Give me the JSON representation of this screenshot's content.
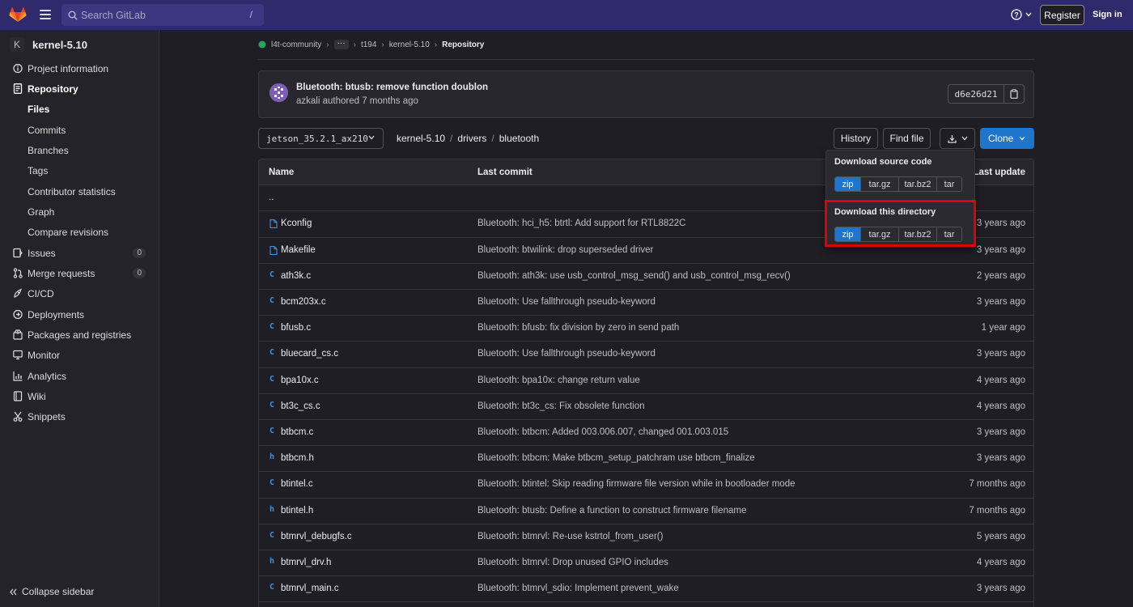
{
  "topbar": {
    "search_placeholder": "Search GitLab",
    "search_shortcut": "/",
    "register_label": "Register",
    "signin_label": "Sign in",
    "logo_icon": "gitlab-tanuki-icon",
    "help_icon": "help-icon"
  },
  "sidebar": {
    "project_initial": "K",
    "project_name": "kernel-5.10",
    "items": [
      {
        "label": "Project information",
        "icon": "info-icon"
      },
      {
        "label": "Repository",
        "icon": "doc-icon"
      },
      {
        "label": "Files"
      },
      {
        "label": "Commits"
      },
      {
        "label": "Branches"
      },
      {
        "label": "Tags"
      },
      {
        "label": "Contributor statistics"
      },
      {
        "label": "Graph"
      },
      {
        "label": "Compare revisions"
      },
      {
        "label": "Issues",
        "icon": "issues-icon",
        "count": "0"
      },
      {
        "label": "Merge requests",
        "icon": "merge-request-icon",
        "count": "0"
      },
      {
        "label": "CI/CD",
        "icon": "rocket-icon"
      },
      {
        "label": "Deployments",
        "icon": "deployments-icon"
      },
      {
        "label": "Packages and registries",
        "icon": "package-icon"
      },
      {
        "label": "Monitor",
        "icon": "monitor-icon"
      },
      {
        "label": "Analytics",
        "icon": "chart-icon"
      },
      {
        "label": "Wiki",
        "icon": "book-icon"
      },
      {
        "label": "Snippets",
        "icon": "snippet-icon"
      }
    ],
    "collapse_label": "Collapse sidebar"
  },
  "breadcrumb": {
    "items": [
      "l4t-community",
      "t194",
      "kernel-5.10",
      "Repository"
    ],
    "ellipsis": "···"
  },
  "commit": {
    "title": "Bluetooth: btusb: remove function doublon",
    "author": "azkali",
    "verb": "authored",
    "time": "7 months ago",
    "sha": "d6e26d21"
  },
  "repo": {
    "branch": "jetson_35.2.1_ax210",
    "path": [
      "kernel-5.10",
      "drivers",
      "bluetooth"
    ],
    "history_label": "History",
    "find_file_label": "Find file",
    "clone_label": "Clone"
  },
  "download_menu": {
    "source_title": "Download source code",
    "dir_title": "Download this directory",
    "formats": [
      "zip",
      "tar.gz",
      "tar.bz2",
      "tar"
    ]
  },
  "table": {
    "headers": [
      "Name",
      "Last commit",
      "Last update"
    ],
    "parent": "..",
    "rows": [
      {
        "name": "Kconfig",
        "type": "file",
        "msg": "Bluetooth: hci_h5: btrtl: Add support for RTL8822C",
        "updated": "3 years ago"
      },
      {
        "name": "Makefile",
        "type": "file",
        "msg": "Bluetooth: btwilink: drop superseded driver",
        "updated": "3 years ago"
      },
      {
        "name": "ath3k.c",
        "type": "c",
        "msg": "Bluetooth: ath3k: use usb_control_msg_send() and usb_control_msg_recv()",
        "updated": "2 years ago"
      },
      {
        "name": "bcm203x.c",
        "type": "c",
        "msg": "Bluetooth: Use fallthrough pseudo-keyword",
        "updated": "3 years ago"
      },
      {
        "name": "bfusb.c",
        "type": "c",
        "msg": "Bluetooth: bfusb: fix division by zero in send path",
        "updated": "1 year ago"
      },
      {
        "name": "bluecard_cs.c",
        "type": "c",
        "msg": "Bluetooth: Use fallthrough pseudo-keyword",
        "updated": "3 years ago"
      },
      {
        "name": "bpa10x.c",
        "type": "c",
        "msg": "Bluetooth: bpa10x: change return value",
        "updated": "4 years ago"
      },
      {
        "name": "bt3c_cs.c",
        "type": "c",
        "msg": "Bluetooth: bt3c_cs: Fix obsolete function",
        "updated": "4 years ago"
      },
      {
        "name": "btbcm.c",
        "type": "c",
        "msg": "Bluetooth: btbcm: Added 003.006.007, changed 001.003.015",
        "updated": "3 years ago"
      },
      {
        "name": "btbcm.h",
        "type": "h",
        "msg": "Bluetooth: btbcm: Make btbcm_setup_patchram use btbcm_finalize",
        "updated": "3 years ago"
      },
      {
        "name": "btintel.c",
        "type": "c",
        "msg": "Bluetooth: btintel: Skip reading firmware file version while in bootloader mode",
        "updated": "7 months ago"
      },
      {
        "name": "btintel.h",
        "type": "h",
        "msg": "Bluetooth: btusb: Define a function to construct firmware filename",
        "updated": "7 months ago"
      },
      {
        "name": "btmrvl_debugfs.c",
        "type": "c",
        "msg": "Bluetooth: btmrvl: Re-use kstrtol_from_user()",
        "updated": "5 years ago"
      },
      {
        "name": "btmrvl_drv.h",
        "type": "h",
        "msg": "Bluetooth: btmrvl: Drop unused GPIO includes",
        "updated": "4 years ago"
      },
      {
        "name": "btmrvl_main.c",
        "type": "c",
        "msg": "Bluetooth: btmrvl_sdio: Implement prevent_wake",
        "updated": "3 years ago"
      }
    ]
  },
  "colors": {
    "topbar": "#2f2a6b",
    "accent": "#1f75cb",
    "highlight": "#e00000"
  }
}
